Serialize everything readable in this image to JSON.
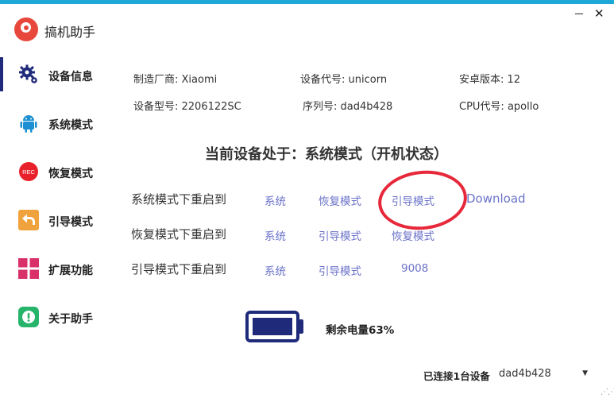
{
  "app": {
    "title": "搞机助手",
    "minimize": "－",
    "close": "✕"
  },
  "sidebar": {
    "items": [
      {
        "label": "设备信息",
        "icon": "gear-icon"
      },
      {
        "label": "系统模式",
        "icon": "android-icon"
      },
      {
        "label": "恢复模式",
        "icon": "rec-icon",
        "icon_text": "REC"
      },
      {
        "label": "引导模式",
        "icon": "back-arrow-icon"
      },
      {
        "label": "扩展功能",
        "icon": "grid-icon"
      },
      {
        "label": "关于助手",
        "icon": "info-icon"
      }
    ],
    "active_index": 0
  },
  "device_info": {
    "manufacturer": "制造厂商: Xiaomi",
    "codename": "设备代号: unicorn",
    "android_version": "安卓版本: 12",
    "model": "设备型号: 2206122SC",
    "serial": "序列号: dad4b428",
    "cpu": "CPU代号: apollo"
  },
  "status_title": "当前设备处于：系统模式（开机状态）",
  "reboot_rows": [
    {
      "label": "系统模式下重启到",
      "options": [
        "系统",
        "恢复模式",
        "引导模式",
        "Download"
      ]
    },
    {
      "label": "恢复模式下重启到",
      "options": [
        "系统",
        "引导模式",
        "恢复模式"
      ]
    },
    {
      "label": "引导模式下重启到",
      "options": [
        "系统",
        "引导模式",
        "9008"
      ]
    }
  ],
  "battery": {
    "text": "剩余电量63%",
    "level": 0.63
  },
  "footer": {
    "connected_label": "已连接1台设备",
    "selected_device": "dad4b428"
  },
  "colors": {
    "accent": "#1f2a7a",
    "link": "#6b73c8",
    "annotation": "#e6283a",
    "topbar": "#1ea8d8"
  }
}
